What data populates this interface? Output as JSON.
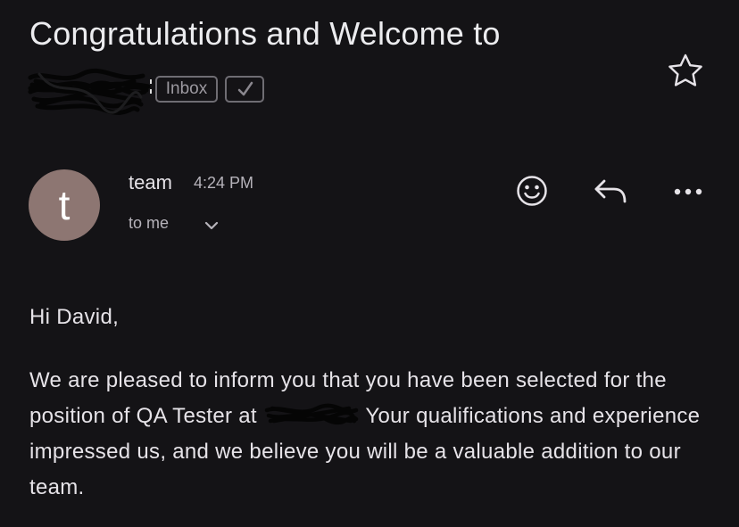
{
  "email": {
    "subject": "Congratulations and Welcome to",
    "labels": [
      "Inbox"
    ],
    "sender": {
      "name": "team",
      "initial": "t",
      "avatar_color": "#8d7672"
    },
    "time": "4:24 PM",
    "recipient": "to me",
    "body": {
      "greeting": "Hi David,",
      "paragraph_before": "We are pleased to inform you that you have been selected for the position of QA Tester at",
      "paragraph_after": " Your qualifications and experience impressed us, and we believe you will be a valuable addition to our team."
    }
  },
  "icons": {
    "star": "star-icon",
    "done": "checkmark-icon",
    "emoji": "smiley-icon",
    "reply": "reply-icon",
    "more": "more-horizontal-icon",
    "expand": "chevron-down-icon"
  },
  "colors": {
    "background": "#141316",
    "text": "#e6e3e8",
    "secondary_text": "#b6b3ba",
    "chip_border": "#6f6d73"
  }
}
